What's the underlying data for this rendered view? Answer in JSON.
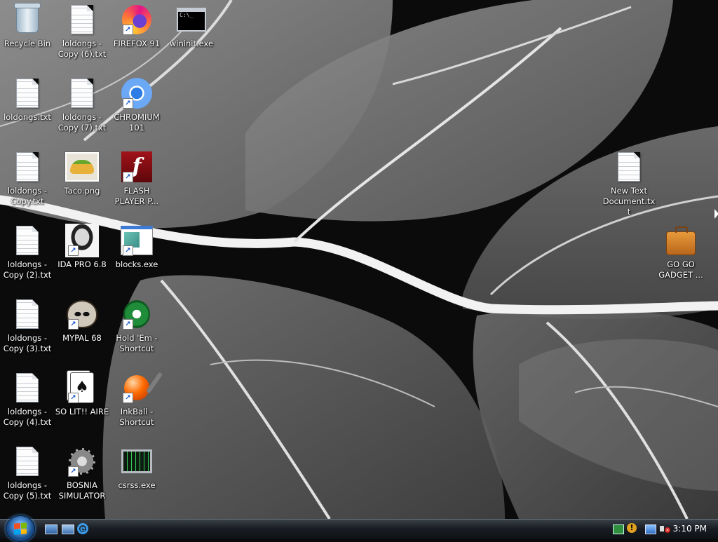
{
  "desktop": {
    "icons": [
      {
        "name": "recycle-bin-icon",
        "label": "Recycle Bin",
        "type": "recycle",
        "shortcut": false
      },
      {
        "name": "text-file-icon",
        "label": "loldongs -\nCopy (6).txt",
        "type": "txt",
        "shortcut": false
      },
      {
        "name": "firefox-icon",
        "label": "FIREFOX 91",
        "type": "firefox",
        "shortcut": true
      },
      {
        "name": "console-icon",
        "label": "wininit.exe",
        "type": "console",
        "shortcut": false
      },
      {
        "name": "text-file-icon",
        "label": "loldongs.txt",
        "type": "txt",
        "shortcut": false
      },
      {
        "name": "text-file-icon",
        "label": "loldongs -\nCopy (7).txt",
        "type": "txt",
        "shortcut": false
      },
      {
        "name": "chromium-icon",
        "label": "CHROMIUM\n101",
        "type": "chromium",
        "shortcut": true
      },
      {
        "name": "text-file-icon",
        "label": "loldongs -\nCopy.txt",
        "type": "txt",
        "shortcut": false
      },
      {
        "name": "image-file-icon",
        "label": "Taco.png",
        "type": "taco",
        "shortcut": false
      },
      {
        "name": "flash-icon",
        "label": "FLASH\nPLAYER P...",
        "type": "flash",
        "shortcut": true
      },
      {
        "name": "text-file-icon",
        "label": "loldongs -\nCopy (2).txt",
        "type": "txt",
        "shortcut": false
      },
      {
        "name": "ida-pro-icon",
        "label": "IDA PRO 6.8",
        "type": "portrait",
        "shortcut": true
      },
      {
        "name": "blocks-icon",
        "label": "blocks.exe",
        "type": "blocks",
        "shortcut": true
      },
      {
        "name": "text-file-icon",
        "label": "loldongs -\nCopy (3).txt",
        "type": "txt",
        "shortcut": false
      },
      {
        "name": "mypal-icon",
        "label": "MYPAL 68",
        "type": "raccoon",
        "shortcut": true
      },
      {
        "name": "poker-chips-icon",
        "label": "Hold 'Em -\nShortcut",
        "type": "chips",
        "shortcut": true
      },
      {
        "name": "text-file-icon",
        "label": "loldongs -\nCopy (4).txt",
        "type": "txt",
        "shortcut": false
      },
      {
        "name": "solitaire-icon",
        "label": "SO LIT!! AIRE",
        "type": "cards",
        "shortcut": true
      },
      {
        "name": "inkball-icon",
        "label": "InkBall -\nShortcut",
        "type": "inkball",
        "shortcut": true
      },
      {
        "name": "text-file-icon",
        "label": "loldongs -\nCopy (5).txt",
        "type": "txt",
        "shortcut": false
      },
      {
        "name": "gear-icon",
        "label": "BOSNIA\nSIMULATOR",
        "type": "gear",
        "shortcut": true
      },
      {
        "name": "monitor-icon",
        "label": "csrss.exe",
        "type": "monitor",
        "shortcut": false
      },
      {
        "name": "text-file-icon",
        "label": "New Text\nDocument.txt",
        "type": "txt",
        "shortcut": false
      },
      {
        "name": "briefcase-icon",
        "label": "GO GO\nGADGET ...",
        "type": "briefcase",
        "shortcut": false
      }
    ]
  },
  "taskbar": {
    "start_icon": "windows-orb-icon",
    "quick_launch": [
      "show-desktop-icon",
      "switch-windows-icon",
      "internet-explorer-icon"
    ],
    "tray_icons": [
      "network-icon",
      "security-alert-icon",
      "connection-icon",
      "volume-muted-icon"
    ],
    "clock": "3:10 PM"
  },
  "colors": {
    "accent": "#1a4e8c",
    "taskbar": "#1a1e24",
    "desktop_bg": "#0b0b0b"
  }
}
